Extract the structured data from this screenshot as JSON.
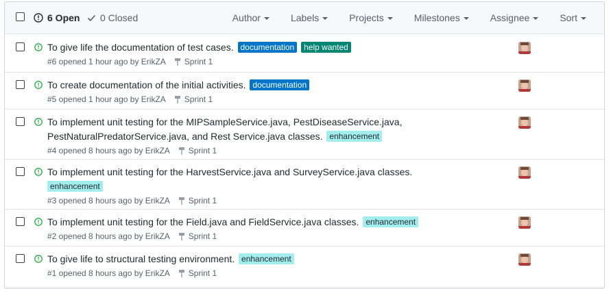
{
  "header": {
    "open_count": "6 Open",
    "closed_count": "0 Closed",
    "filters": [
      "Author",
      "Labels",
      "Projects",
      "Milestones",
      "Assignee",
      "Sort"
    ]
  },
  "colors": {
    "documentation": "#0075ca",
    "help_wanted": "#008672",
    "enhancement": "#a2eeef",
    "open_icon": "#28a745"
  },
  "issues": [
    {
      "title": "To give life the documentation of test cases.",
      "labels": [
        "documentation",
        "help wanted"
      ],
      "meta": "#6 opened 1 hour ago by ErikZA",
      "milestone": "Sprint 1"
    },
    {
      "title": "To create documentation of the initial activities.",
      "labels": [
        "documentation"
      ],
      "meta": "#5 opened 1 hour ago by ErikZA",
      "milestone": "Sprint 1"
    },
    {
      "title_line1": "To implement unit testing for the MIPSampleService.java, PestDiseaseService.java,",
      "title_line2": "PestNaturalPredatorService.java, and Rest Service.java classes.",
      "labels": [
        "enhancement"
      ],
      "meta": "#4 opened 8 hours ago by ErikZA",
      "milestone": "Sprint 1"
    },
    {
      "title": "To implement unit testing for the HarvestService.java and SurveyService.java classes.",
      "labels": [
        "enhancement"
      ],
      "meta": "#3 opened 8 hours ago by ErikZA",
      "milestone": "Sprint 1"
    },
    {
      "title": "To implement unit testing for the Field.java and FieldService.java classes.",
      "labels": [
        "enhancement"
      ],
      "meta": "#2 opened 8 hours ago by ErikZA",
      "milestone": "Sprint 1"
    },
    {
      "title": "To give life to structural testing environment.",
      "labels": [
        "enhancement"
      ],
      "meta": "#1 opened 8 hours ago by ErikZA",
      "milestone": "Sprint 1"
    }
  ]
}
